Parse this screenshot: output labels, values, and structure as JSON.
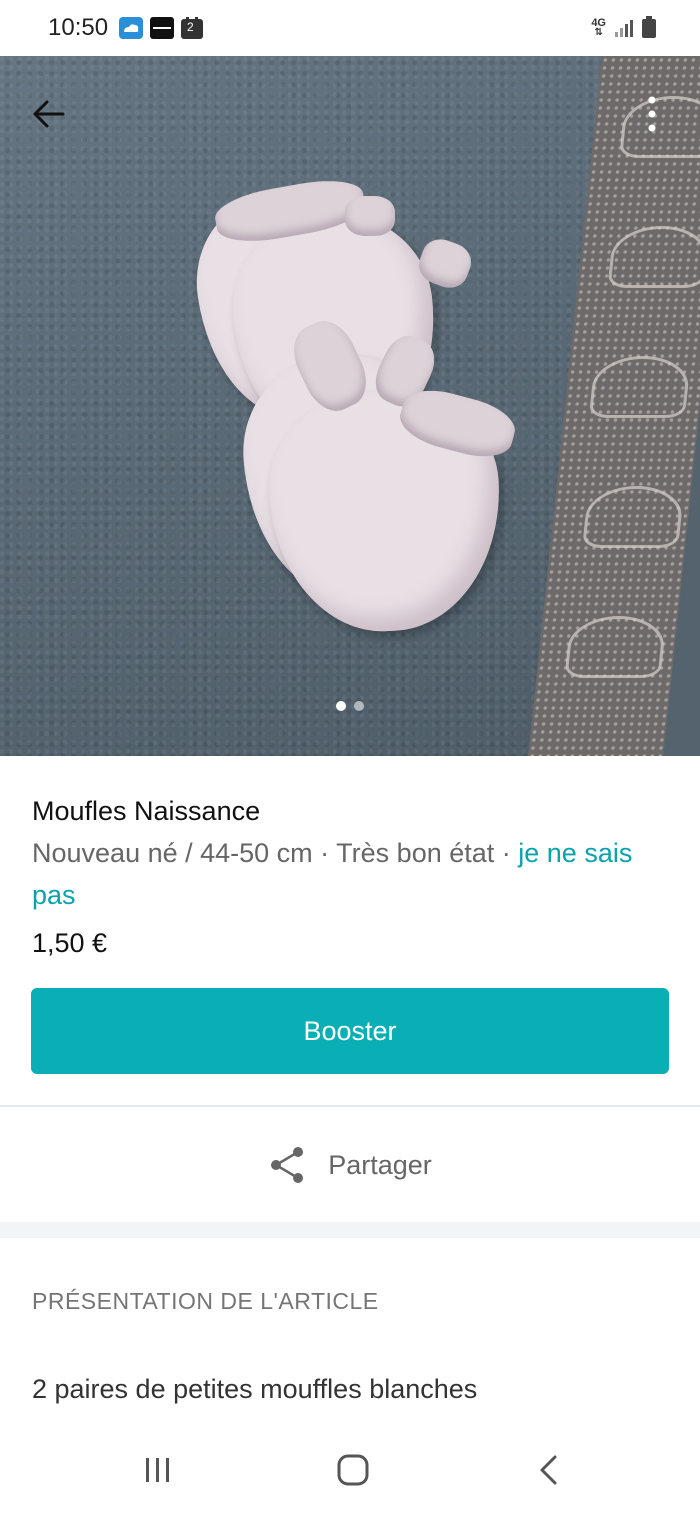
{
  "status_bar": {
    "time": "10:50",
    "calendar_badge": "2",
    "network": "4G",
    "icons": [
      "cloud-app-icon",
      "news-app-icon",
      "calendar-icon",
      "network-4g-icon",
      "signal-icon",
      "battery-icon"
    ]
  },
  "gallery": {
    "image_count": 2,
    "active_index": 0,
    "icons": [
      "arrow-back-icon",
      "more-vert-icon"
    ]
  },
  "item": {
    "title": "Moufles Naissance",
    "size_condition": "Nouveau né / 44-50 cm · Très bon état · ",
    "brand": "je ne sais pas",
    "price": "1,50 €"
  },
  "actions": {
    "booster_label": "Booster",
    "share_label": "Partager"
  },
  "description": {
    "heading": "PRÉSENTATION DE L'ARTICLE",
    "text": "2 paires de petites mouffles blanches"
  },
  "colors": {
    "accent": "#0aafb6",
    "brand_link": "#09a3ad",
    "muted_text": "#666666"
  }
}
